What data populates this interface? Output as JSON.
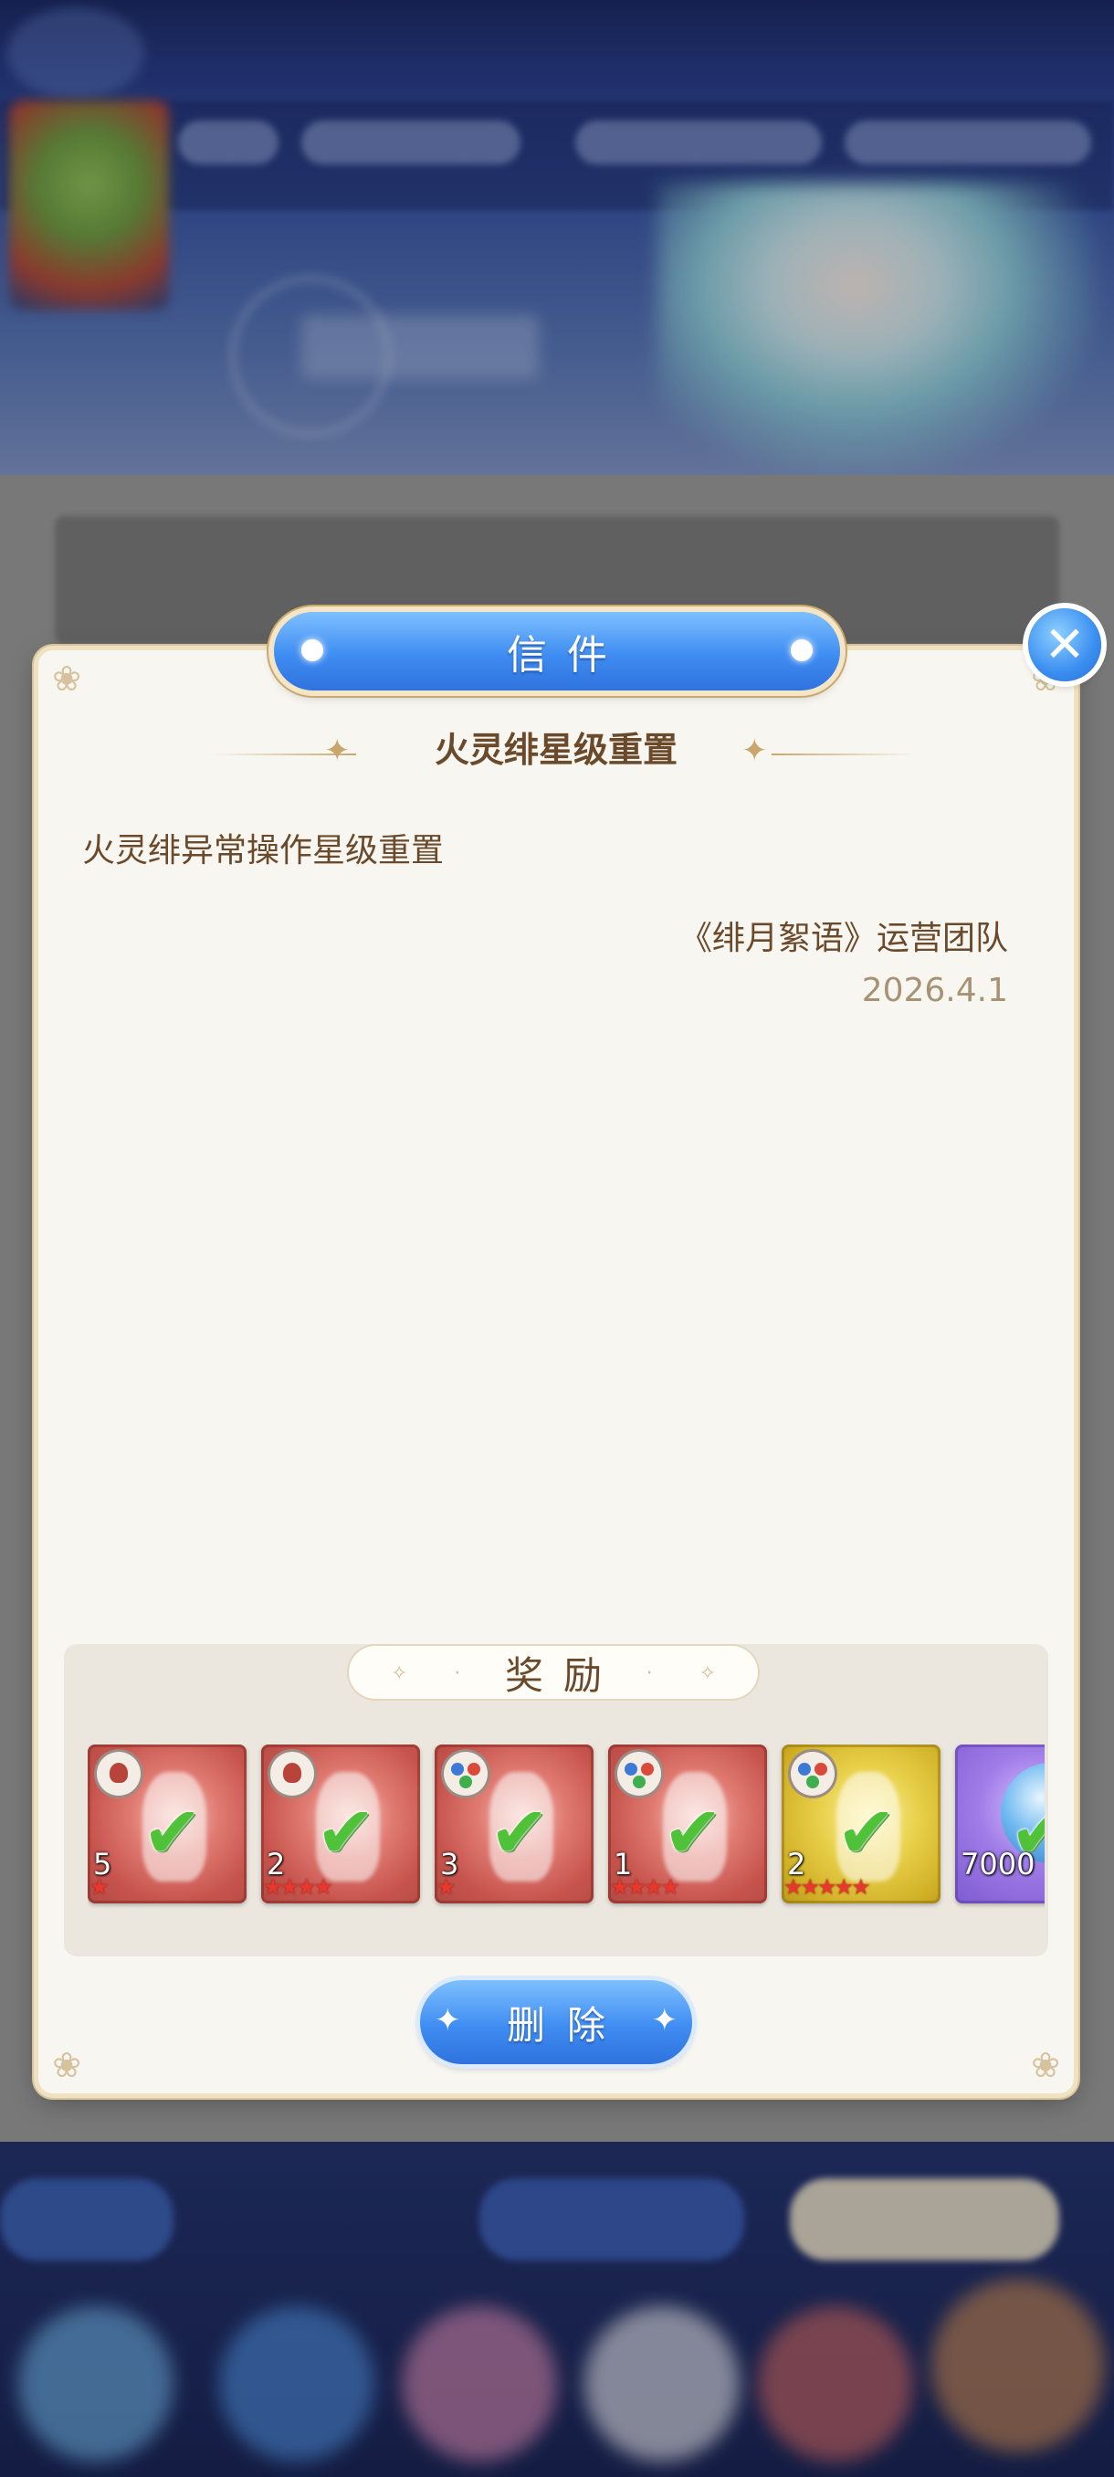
{
  "dialog": {
    "title": "信件",
    "close_icon": "close-icon",
    "subject": "火灵绯星级重置",
    "body": "火灵绯异常操作星级重置",
    "signature": "《绯月絮语》运营团队",
    "date": "2026.4.1",
    "rewards_label": "奖励",
    "delete_label": "删除"
  },
  "rewards": [
    {
      "count": "5",
      "stars": "★",
      "element": "fire-icon",
      "claimed": true,
      "color": "red"
    },
    {
      "count": "2",
      "stars": "★★★★",
      "element": "fire-icon",
      "claimed": true,
      "color": "red"
    },
    {
      "count": "3",
      "stars": "★",
      "element": "tri-element-icon",
      "claimed": true,
      "color": "red"
    },
    {
      "count": "1",
      "stars": "★★★★",
      "element": "tri-element-icon",
      "claimed": true,
      "color": "red"
    },
    {
      "count": "2",
      "stars": "★★★★★",
      "element": "tri-element-icon",
      "claimed": true,
      "color": "gold"
    },
    {
      "count": "7000",
      "stars": "",
      "element": "crystal-orb-icon",
      "claimed": true,
      "color": "purple"
    }
  ],
  "colors": {
    "accent_blue": "#3f8df2",
    "text_brown": "#6a4a2b",
    "date_gray": "#a89274",
    "panel_bg": "#f8f6f1",
    "check_green": "#4fc23a",
    "star_red": "#e8382d"
  }
}
